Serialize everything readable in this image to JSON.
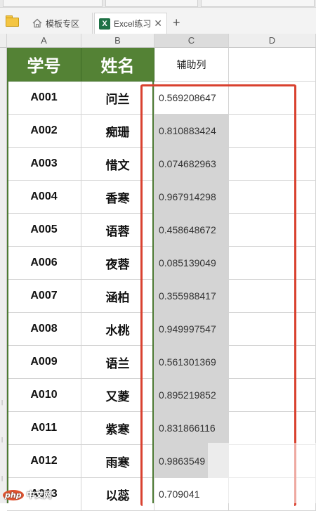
{
  "tabs": {
    "templates_label": "模板专区",
    "excel_label": "Excel练习",
    "close_glyph": "✕",
    "add_glyph": "+"
  },
  "columns": [
    "A",
    "B",
    "C",
    "D"
  ],
  "headers": {
    "a": "学号",
    "b": "姓名",
    "c": "辅助列"
  },
  "rows": [
    {
      "id": "A001",
      "name": "问兰",
      "value": "0.569208647"
    },
    {
      "id": "A002",
      "name": "痴珊",
      "value": "0.810883424"
    },
    {
      "id": "A003",
      "name": "惜文",
      "value": "0.074682963"
    },
    {
      "id": "A004",
      "name": "香寒",
      "value": "0.967914298"
    },
    {
      "id": "A005",
      "name": "语蓉",
      "value": "0.458648672"
    },
    {
      "id": "A006",
      "name": "夜蓉",
      "value": "0.085139049"
    },
    {
      "id": "A007",
      "name": "涵柏",
      "value": "0.355988417"
    },
    {
      "id": "A008",
      "name": "水桃",
      "value": "0.949997547"
    },
    {
      "id": "A009",
      "name": "语兰",
      "value": "0.561301369"
    },
    {
      "id": "A010",
      "name": "又菱",
      "value": "0.895219852"
    },
    {
      "id": "A011",
      "name": "紫寒",
      "value": "0.831866116"
    },
    {
      "id": "A012",
      "name": "雨寒",
      "value": "0.9863549"
    },
    {
      "id": "A013",
      "name": "以蕊",
      "value": "0.709041"
    }
  ],
  "watermark": {
    "php": "php",
    "site": "中文网"
  },
  "colors": {
    "header_green": "#548235",
    "highlight_red": "#d9412f",
    "selection_gray": "#d4d4d4",
    "excel_icon": "#1e7145"
  }
}
